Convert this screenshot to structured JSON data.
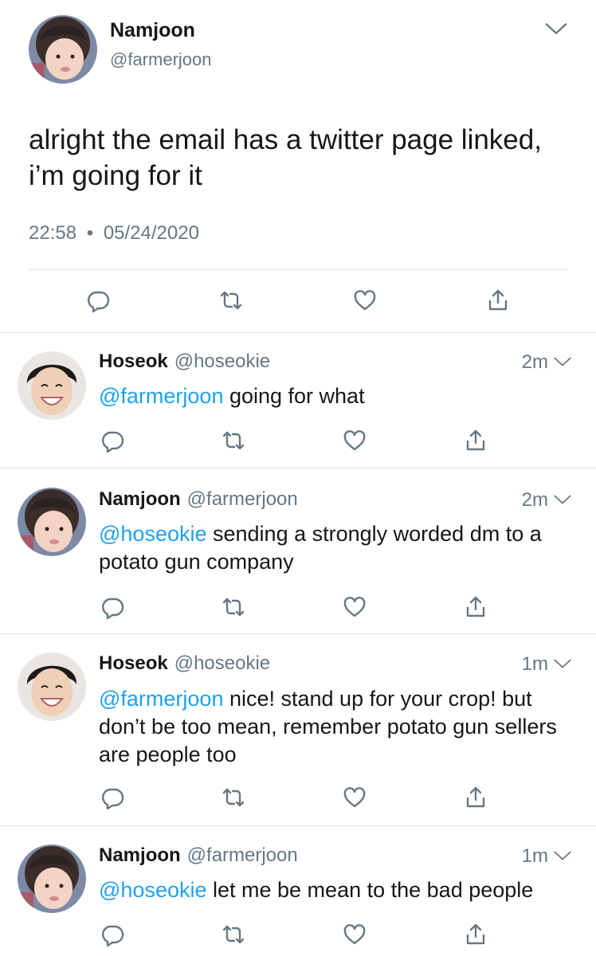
{
  "main_tweet": {
    "author_name": "Namjoon",
    "author_handle": "@farmerjoon",
    "text": "alright the email has a twitter page linked, i’m going for it",
    "time": "22:58",
    "separator": "•",
    "date": "05/24/2020",
    "avatar_icon": "profile-photo-namjoon"
  },
  "replies": [
    {
      "author_name": "Hoseok",
      "author_handle": "@hoseokie",
      "time": "2m",
      "mention": "@farmerjoon",
      "text": " going for what",
      "avatar_icon": "profile-photo-hoseok"
    },
    {
      "author_name": "Namjoon",
      "author_handle": "@farmerjoon",
      "time": "2m",
      "mention": "@hoseokie",
      "text": " sending a strongly worded dm to a potato gun company",
      "avatar_icon": "profile-photo-namjoon"
    },
    {
      "author_name": "Hoseok",
      "author_handle": "@hoseokie",
      "time": "1m",
      "mention": "@farmerjoon",
      "text": " nice! stand up for your crop! but don’t be too mean, remember potato gun sellers are people too",
      "avatar_icon": "profile-photo-hoseok"
    },
    {
      "author_name": "Namjoon",
      "author_handle": "@farmerjoon",
      "time": "1m",
      "mention": "@hoseokie",
      "text": " let me be mean to the bad people",
      "avatar_icon": "profile-photo-namjoon"
    }
  ],
  "colors": {
    "link": "#1da1f2",
    "secondary_text": "#657786",
    "divider": "#e1e4e8"
  },
  "icons": [
    "reply-icon",
    "retweet-icon",
    "like-icon",
    "share-icon",
    "chevron-down-icon"
  ]
}
